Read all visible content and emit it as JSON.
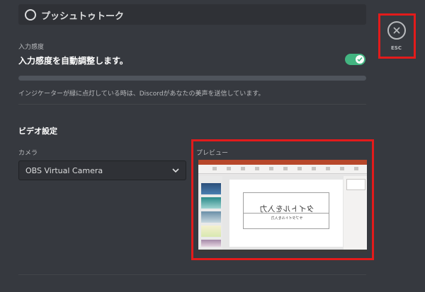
{
  "voice": {
    "push_to_talk_label": "プッシュトゥトーク",
    "input_sensitivity_label": "入力感度",
    "auto_adjust_label": "入力感度を自動調整します。",
    "auto_adjust_enabled": true,
    "hint_text": "インジケーターが緑に点灯している時は、Discordがあなたの美声を送信しています。"
  },
  "video": {
    "section_title": "ビデオ設定",
    "camera_label": "カメラ",
    "camera_selected": "OBS Virtual Camera",
    "preview_label": "プレビュー",
    "preview_slide_title": "タイトルを入力",
    "preview_slide_subtitle": "サブタイトルを入力"
  },
  "close": {
    "esc_label": "ESC",
    "icon": "close-icon"
  },
  "colors": {
    "background": "#36393f",
    "toggle_on": "#43b581",
    "highlight": "#e31b1b"
  }
}
